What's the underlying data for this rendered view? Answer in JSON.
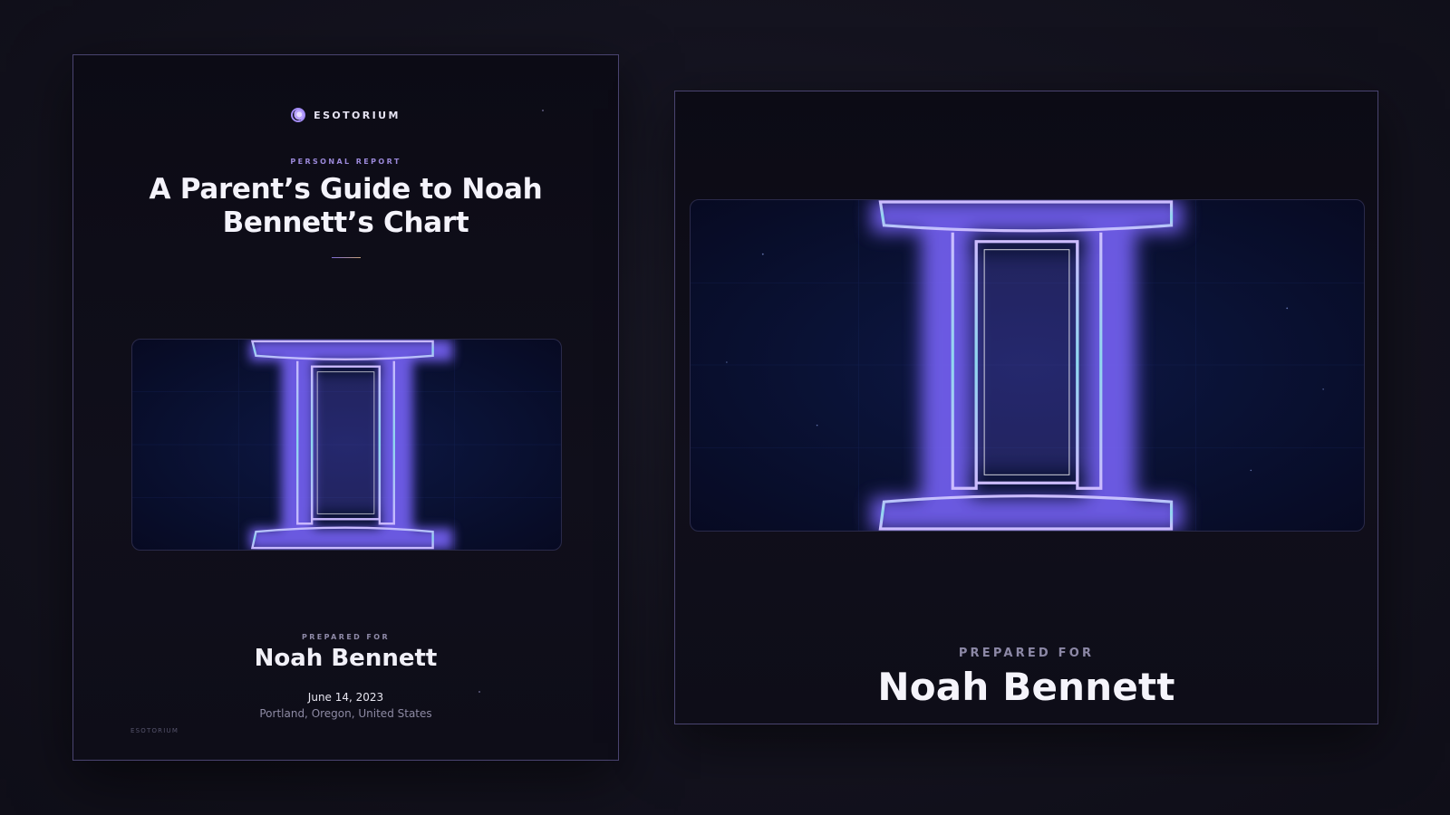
{
  "cover": {
    "brand": "ESOTORIUM",
    "kicker": "PERSONAL REPORT",
    "title": "A Parent’s Guide to Noah Bennett’s Chart",
    "prepared_label": "PREPARED FOR",
    "name": "Noah Bennett",
    "date": "June 14, 2023",
    "location": "Portland, Oregon, United States",
    "footer": "ESOTORIUM"
  },
  "preview": {
    "prepared_label": "PREPARED FOR",
    "name": "Noah Bennett"
  },
  "artwork": {
    "symbol": "gemini-glyph",
    "accent": "#b9a8ff",
    "glow": "#6fd0e8",
    "background": "#0a1235"
  }
}
